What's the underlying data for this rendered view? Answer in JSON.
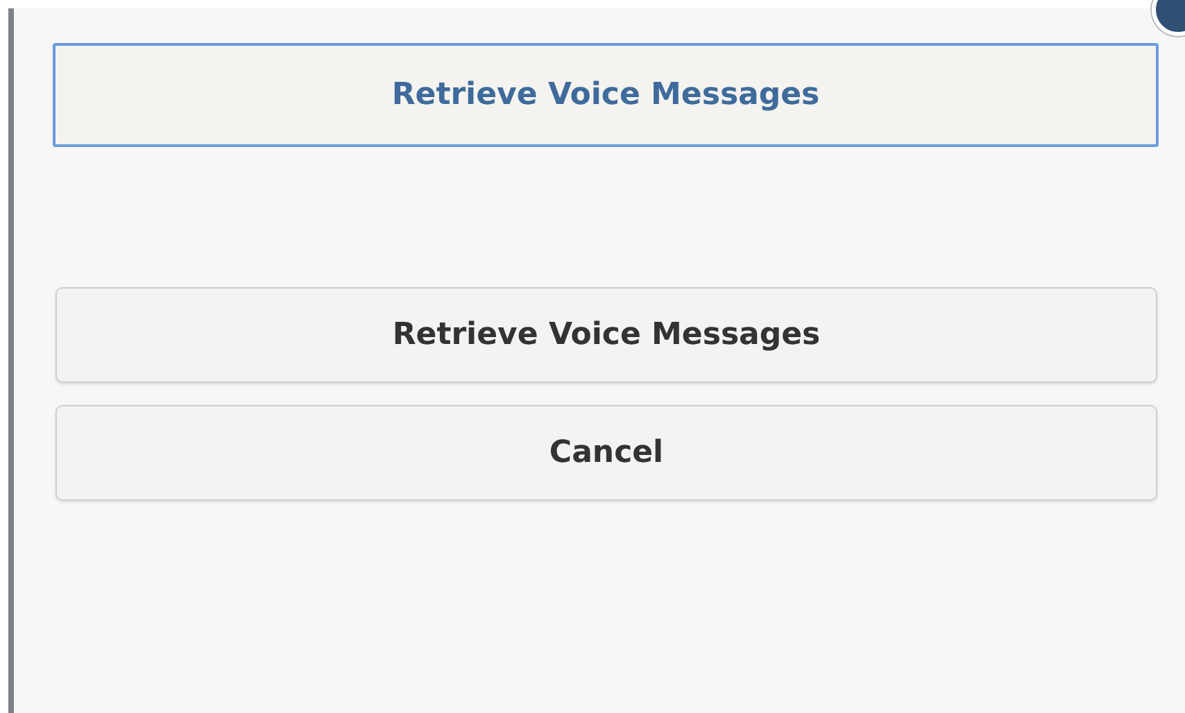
{
  "dialog": {
    "title": "Retrieve Voice Messages",
    "buttons": [
      {
        "label": "Retrieve Voice Messages"
      },
      {
        "label": "Cancel"
      }
    ]
  }
}
